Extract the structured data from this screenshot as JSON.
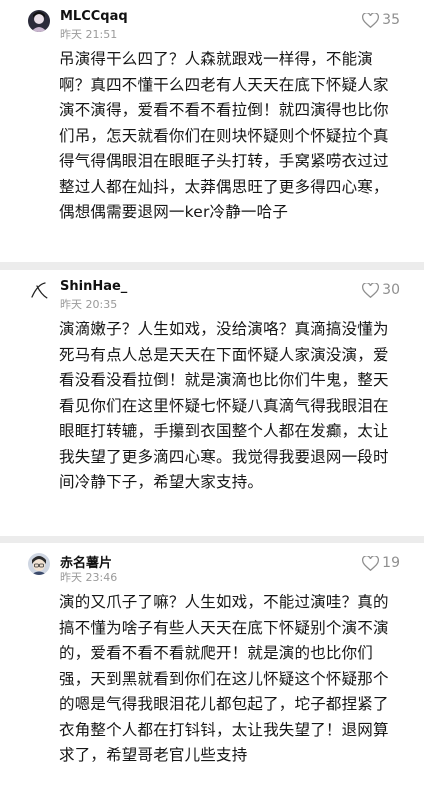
{
  "comments": [
    {
      "username": "MLCCqaq",
      "time": "昨天 21:51",
      "likes": "35",
      "text": "吊演得干么四了？人森就跟戏一样得，不能演啊？真四不懂干么四老有人天天在底下怀疑人家演不演得，爱看不看不看拉倒！就四演得也比你们吊，怎天就看你们在则块怀疑则个怀疑拉个真得气得偶眼泪在眼眶子头打转，手窝紧唠衣过过整过人都在灿抖，太莽偶思旺了更多得四心寒，偶想偶需要退网一ker冷静一哈子"
    },
    {
      "username": "ShinHae_",
      "time": "昨天 20:35",
      "likes": "30",
      "text": "演滴嫩子？人生如戏，没给演咯？真滴搞没懂为死马有点人总是天天在下面怀疑人家演没演，爱看没看没看拉倒！就是演滴也比你们牛鬼，整天看见你们在这里怀疑七怀疑八真滴气得我眼泪在眼眶打转辘，手攥到衣国整个人都在发癫，太让我失望了更多滴四心寒。我觉得我要退网一段时间冷静下子，希望大家支持。"
    },
    {
      "username": "赤名薯片",
      "time": "昨天 23:46",
      "likes": "19",
      "text": "演的又爪子了嘛？人生如戏，不能过演哇？真的搞不懂为啥子有些人天天在底下怀疑别个演不演的，爱看不看不看就爬开！就是演的也比你们强，天到黑就看到你们在这儿怀疑这个怀疑那个的嗯是气得我眼泪花儿都包起了，坨子都捏紧了衣角整个人都在打钭钭，太让我失望了！退网算求了，希望哥老官儿些支持"
    }
  ]
}
